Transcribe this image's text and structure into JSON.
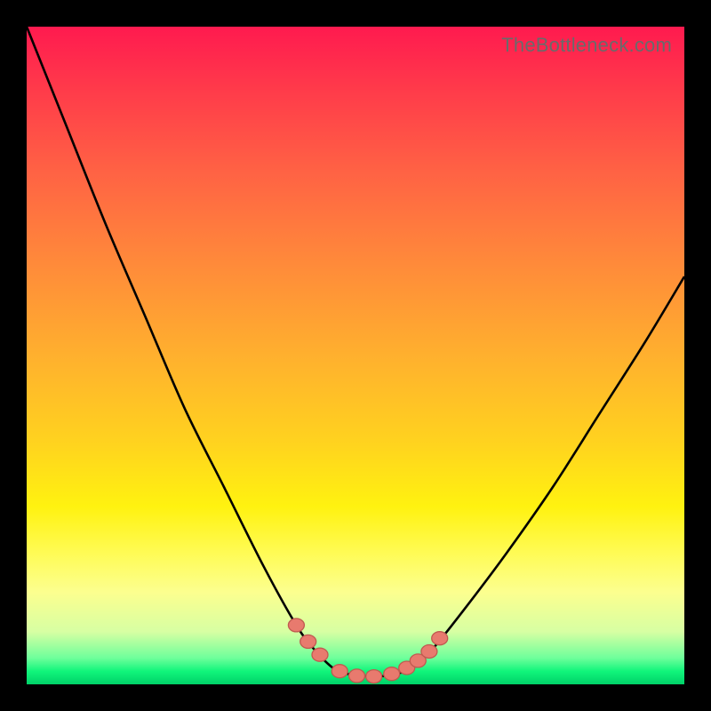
{
  "watermark": "TheBottleneck.com",
  "colors": {
    "frame": "#000000",
    "curve": "#000000",
    "marker_fill": "#e87a6e",
    "marker_stroke": "#c05a50"
  },
  "chart_data": {
    "type": "line",
    "title": "",
    "xlabel": "",
    "ylabel": "",
    "xlim": [
      0,
      100
    ],
    "ylim": [
      0,
      100
    ],
    "grid": false,
    "legend": false,
    "series": [
      {
        "name": "bottleneck-curve",
        "x": [
          0,
          6,
          12,
          18,
          24,
          30,
          36,
          41,
          44,
          47,
          50,
          53,
          56,
          59,
          62,
          67,
          73,
          80,
          87,
          94,
          100
        ],
        "y": [
          100,
          85,
          70,
          56,
          42,
          30,
          18,
          9,
          5,
          2.2,
          1.4,
          1.2,
          1.5,
          2.8,
          5.7,
          12,
          20,
          30,
          41,
          52,
          62
        ]
      }
    ],
    "markers": {
      "name": "trough-points",
      "x": [
        41.0,
        42.8,
        44.6,
        47.6,
        50.2,
        52.8,
        55.5,
        57.8,
        59.5,
        61.2,
        62.8
      ],
      "y": [
        9.0,
        6.5,
        4.5,
        2.0,
        1.3,
        1.2,
        1.6,
        2.5,
        3.6,
        5.0,
        7.0
      ]
    }
  }
}
